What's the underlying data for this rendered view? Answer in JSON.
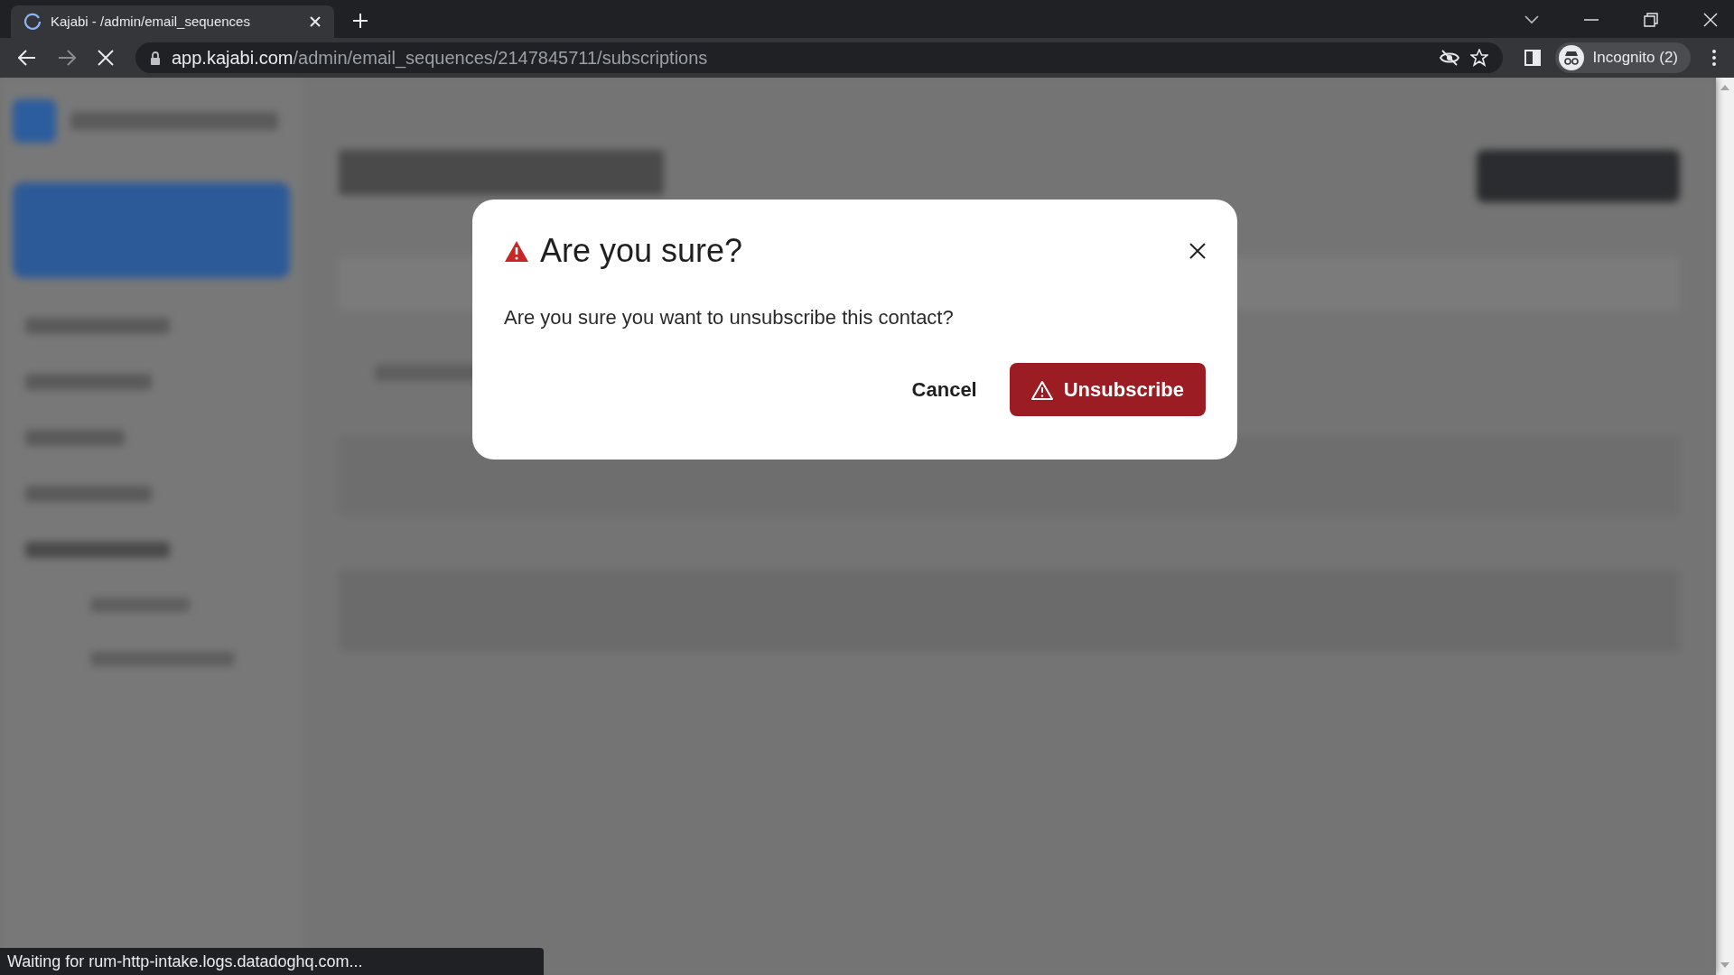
{
  "browser": {
    "tab": {
      "title": "Kajabi - /admin/email_sequences",
      "loading": true
    },
    "address": {
      "host": "app.kajabi.com",
      "path": "/admin/email_sequences/2147845711/subscriptions"
    },
    "profile": "Incognito (2)",
    "status_bar": "Waiting for rum-http-intake.logs.datadoghq.com..."
  },
  "dialog": {
    "title": "Are you sure?",
    "message": "Are you sure you want to unsubscribe this contact?",
    "buttons": [
      {
        "label": "Cancel",
        "kind": "secondary"
      },
      {
        "label": "Unsubscribe",
        "kind": "danger"
      }
    ]
  }
}
